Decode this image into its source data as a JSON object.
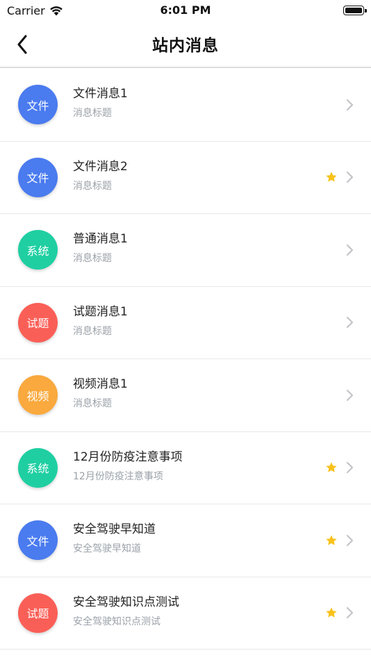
{
  "status_bar": {
    "carrier": "Carrier",
    "time": "6:01 PM",
    "icons": [
      "wifi-icon",
      "battery-icon"
    ]
  },
  "nav": {
    "title": "站内消息",
    "back_icon": "chevron-left-icon"
  },
  "colors": {
    "file": "#4a7bef",
    "system": "#1fcfa2",
    "exam": "#fa5f57",
    "video": "#f9a93d",
    "star": "#f8c21b",
    "chevron": "#c4c4c8"
  },
  "messages": [
    {
      "badge": "文件",
      "badge_color": "#4a7bef",
      "title": "文件消息1",
      "subtitle": "消息标题",
      "starred": false
    },
    {
      "badge": "文件",
      "badge_color": "#4a7bef",
      "title": "文件消息2",
      "subtitle": "消息标题",
      "starred": true
    },
    {
      "badge": "系统",
      "badge_color": "#1fcfa2",
      "title": "普通消息1",
      "subtitle": "消息标题",
      "starred": false
    },
    {
      "badge": "试题",
      "badge_color": "#fa5f57",
      "title": "试题消息1",
      "subtitle": "消息标题",
      "starred": false
    },
    {
      "badge": "视频",
      "badge_color": "#f9a93d",
      "title": "视频消息1",
      "subtitle": "消息标题",
      "starred": false
    },
    {
      "badge": "系统",
      "badge_color": "#1fcfa2",
      "title": "12月份防疫注意事项",
      "subtitle": "12月份防疫注意事项",
      "starred": true
    },
    {
      "badge": "文件",
      "badge_color": "#4a7bef",
      "title": "安全驾驶早知道",
      "subtitle": "安全驾驶早知道",
      "starred": true
    },
    {
      "badge": "试题",
      "badge_color": "#fa5f57",
      "title": "安全驾驶知识点测试",
      "subtitle": "安全驾驶知识点测试",
      "starred": true
    }
  ]
}
